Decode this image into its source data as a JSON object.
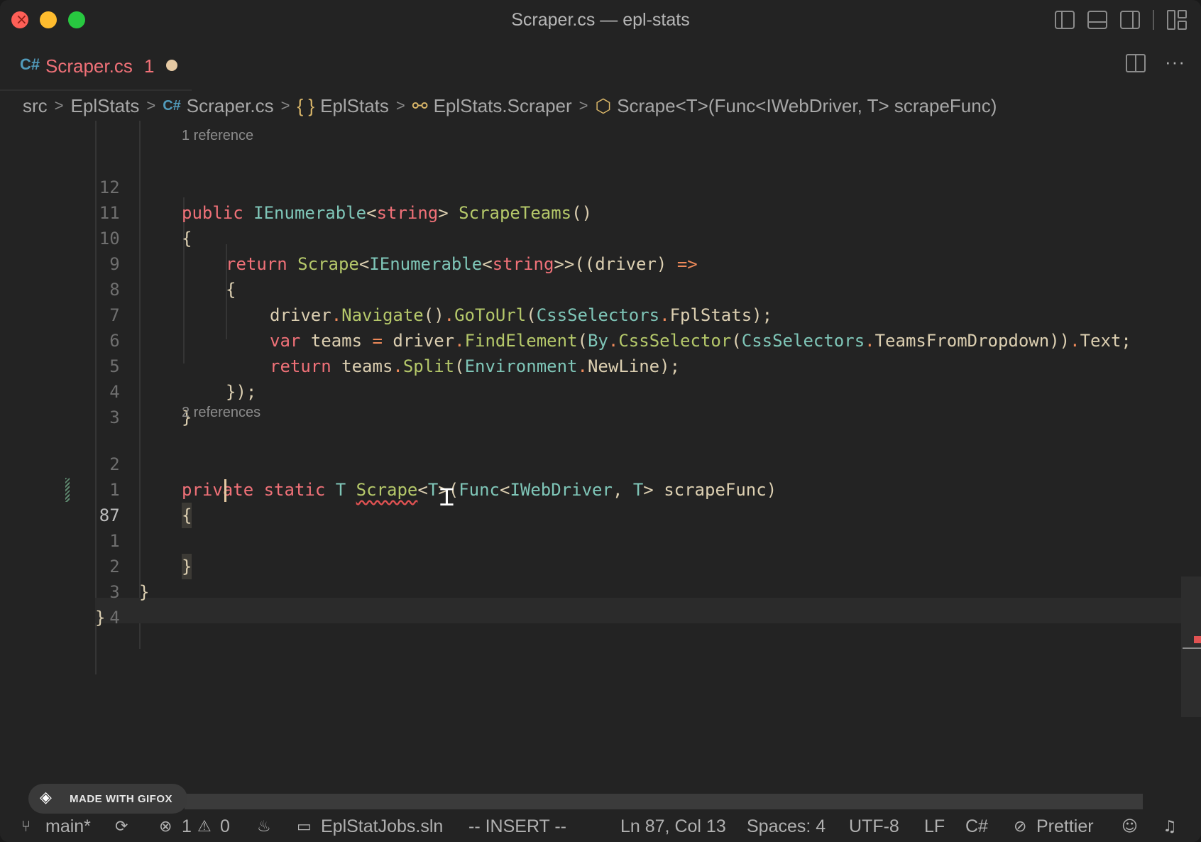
{
  "window": {
    "title": "Scraper.cs — epl-stats"
  },
  "tab": {
    "name": "Scraper.cs",
    "problem_count": "1",
    "icon": "csharp-icon"
  },
  "breadcrumb": {
    "items": [
      "src",
      "EplStats",
      "Scraper.cs",
      "EplStats",
      "EplStats.Scraper",
      "Scrape<T>(Func<IWebDriver, T> scrapeFunc)"
    ]
  },
  "editor": {
    "codelens_1": "1 reference",
    "codelens_2": "2 references",
    "line_numbers": [
      "12",
      "11",
      "10",
      "9",
      "8",
      "7",
      "6",
      "5",
      "4",
      "3",
      "2",
      "1",
      "87",
      "1",
      "2",
      "3",
      "4"
    ],
    "current_line_number": "87"
  },
  "gifox": {
    "label": "MADE WITH GIFOX"
  },
  "statusbar": {
    "branch": "main*",
    "errors": "1",
    "warnings": "0",
    "solution": "EplStatJobs.sln",
    "mode": "-- INSERT --",
    "position": "Ln 87, Col 13",
    "spaces": "Spaces: 4",
    "encoding": "UTF-8",
    "eol": "LF",
    "language": "C#",
    "formatter": "Prettier"
  },
  "colors": {
    "keyword": "#f07178",
    "type": "#7fc6b8",
    "function": "#b5c86a",
    "plain": "#dccfb1",
    "operator": "#ef8a5a",
    "error": "#e05252"
  }
}
